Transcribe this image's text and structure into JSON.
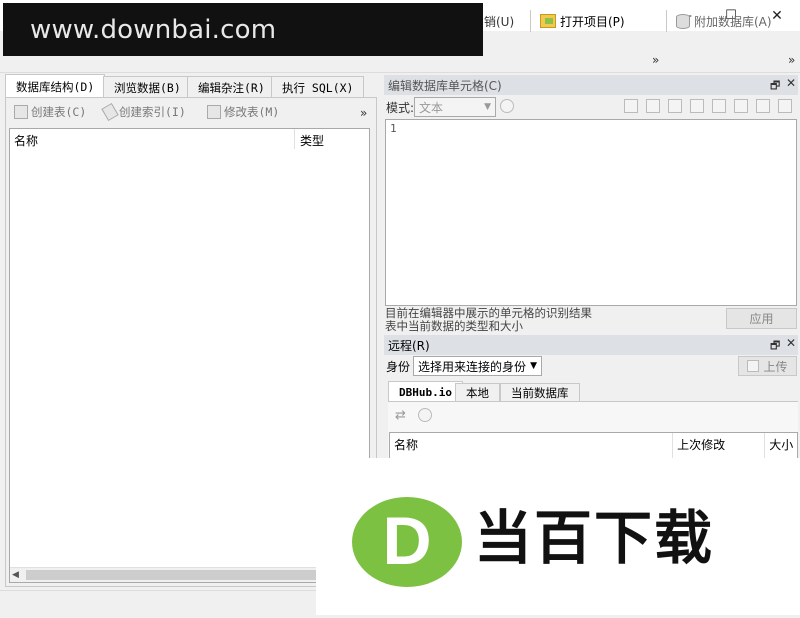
{
  "watermark": {
    "text": "www.downbai.com"
  },
  "window": {
    "minimize_glyph": "—",
    "maximize_glyph": "☐",
    "close_glyph": "✕"
  },
  "toolbar": {
    "partial_label": "销(U)",
    "open_project": "打开项目(P)",
    "attach_db": "附加数据库(A)",
    "chevron": "»"
  },
  "tabs": [
    {
      "label": "数据库结构(D)",
      "active": true
    },
    {
      "label": "浏览数据(B)",
      "active": false
    },
    {
      "label": "编辑杂注(R)",
      "active": false
    },
    {
      "label": "执行 SQL(X)",
      "active": false
    }
  ],
  "structure_toolbar": {
    "create_table": "创建表(C)",
    "create_index": "创建索引(I)",
    "modify_table": "修改表(M)",
    "chevron": "»"
  },
  "structure_table": {
    "col_name": "名称",
    "col_type": "类型"
  },
  "cell_editor": {
    "title": "编辑数据库单元格(C)",
    "mode_label": "模式:",
    "mode_value": "文本",
    "line_number": "1",
    "info_line1": "目前在编辑器中展示的单元格的识别结果",
    "info_line2": "表中当前数据的类型和大小",
    "apply_button": "应用",
    "float_glyph": "🗗",
    "close_glyph": "✕"
  },
  "remote": {
    "title": "远程(R)",
    "identity_label": "身份",
    "identity_value": "选择用来连接的身份",
    "upload_button": "上传",
    "tabs": [
      "DBHub.io",
      "本地",
      "当前数据库"
    ],
    "columns": [
      "名称",
      "上次修改",
      "大小"
    ],
    "float_glyph": "🗗",
    "close_glyph": "✕"
  },
  "promo": {
    "brand_letter": "D",
    "brand_text": "当百下载"
  },
  "colors": {
    "brand_green": "#7dc142",
    "brand_text": "#111111",
    "header_bg": "#dde1e6"
  }
}
